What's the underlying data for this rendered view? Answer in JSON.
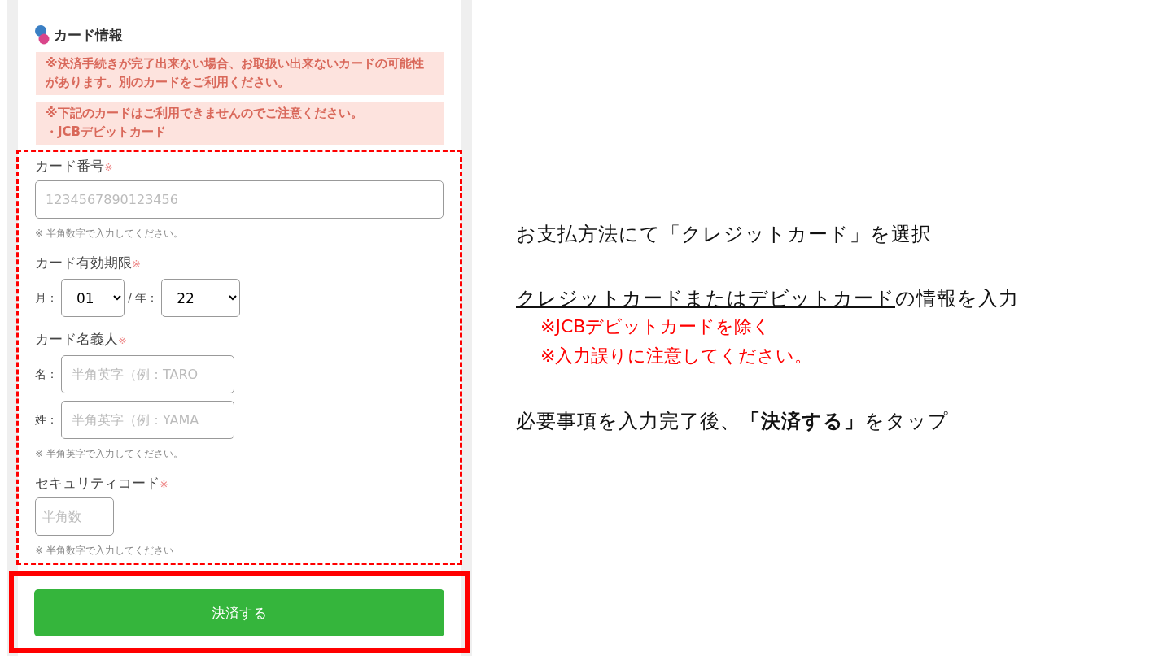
{
  "card_form": {
    "heading": "カード情報",
    "notices": [
      {
        "lines": [
          "※決済手続きが完了出来ない場合、お取扱い出来ないカードの可能性があります。別のカードをご利用ください。"
        ]
      },
      {
        "lines": [
          "※下記のカードはご利用できませんのでご注意ください。",
          "・JCBデビットカード"
        ]
      }
    ],
    "card_number": {
      "label": "カード番号",
      "required_mark": "※",
      "placeholder": "1234567890123456",
      "hint": "※ 半角数字で入力してください。"
    },
    "expiry": {
      "label": "カード有効期限",
      "required_mark": "※",
      "month_label": "月：",
      "month": "01",
      "year_label": "/ 年：",
      "year": "22"
    },
    "holder": {
      "label": "カード名義人",
      "required_mark": "※",
      "first_label": "名：",
      "first_placeholder": "半角英字（例：TARO",
      "last_label": "姓：",
      "last_placeholder": "半角英字（例：YAMA",
      "hint": "※ 半角英字で入力してください。"
    },
    "security_code": {
      "label": "セキュリティコード",
      "required_mark": "※",
      "placeholder": "半角数",
      "hint": "※ 半角数字で入力してください"
    },
    "submit": "決済する"
  },
  "instructions": [
    {
      "kind": "plain",
      "text": "お支払方法にて「クレジットカード」を選択"
    },
    {
      "kind": "underlined",
      "underlined": "クレジットカードまたはデビットカード",
      "rest": "の情報を入力",
      "notes": [
        "※JCBデビットカードを除く",
        "※入力誤りに注意してください。"
      ]
    },
    {
      "kind": "plain",
      "text": "必要事項を入力完了後、**「決済する」**をタップ"
    }
  ]
}
